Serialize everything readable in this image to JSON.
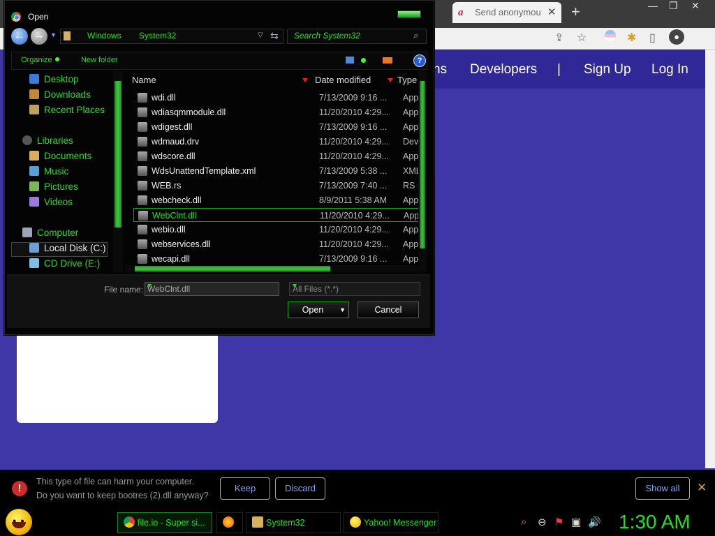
{
  "browser": {
    "tab_title": "Send anonymou",
    "tab_close": "✕",
    "new_tab": "+",
    "window_controls": {
      "minimize": "—",
      "restore": "❐",
      "close": "✕"
    },
    "toolbar_icons": [
      "share-icon",
      "star-icon",
      "profile-icon",
      "extensions-icon",
      "sidepanel-icon",
      "account-icon"
    ]
  },
  "site": {
    "nav_partial": "ns",
    "nav": [
      "Developers",
      "|",
      "Sign Up",
      "Log In"
    ]
  },
  "dialog": {
    "title": "Open",
    "address": [
      "Windows",
      "System32"
    ],
    "search_placeholder": "Search System32",
    "toolbar": {
      "organize": "Organize",
      "new_folder": "New folder",
      "help": "?"
    },
    "nav_pane": [
      {
        "label": "Desktop",
        "color": "#3a7bd5"
      },
      {
        "label": "Downloads",
        "color": "#c08a3a"
      },
      {
        "label": "Recent Places",
        "color": "#c0a060"
      },
      {
        "label": "Libraries",
        "color": "#555555"
      },
      {
        "label": "Documents",
        "color": "#d8b060"
      },
      {
        "label": "Music",
        "color": "#5aa0d8"
      },
      {
        "label": "Pictures",
        "color": "#7ab85a"
      },
      {
        "label": "Videos",
        "color": "#9a7ad8"
      },
      {
        "label": "Computer",
        "color": "#9aa6b8"
      },
      {
        "label": "Local Disk (C:)",
        "color": "#6ea0d8"
      },
      {
        "label": "CD Drive (E:)",
        "color": "#7ac0e8"
      }
    ],
    "columns": {
      "name": "Name",
      "date": "Date modified",
      "type": "Type"
    },
    "files": [
      {
        "name": "wdi.dll",
        "date": "7/13/2009 9:16 ...",
        "type": "Appli"
      },
      {
        "name": "wdiasqmmodule.dll",
        "date": "11/20/2010 4:29...",
        "type": "Appli"
      },
      {
        "name": "wdigest.dll",
        "date": "7/13/2009 9:16 ...",
        "type": "Appli"
      },
      {
        "name": "wdmaud.drv",
        "date": "11/20/2010 4:29...",
        "type": "Devic"
      },
      {
        "name": "wdscore.dll",
        "date": "11/20/2010 4:29...",
        "type": "Appli"
      },
      {
        "name": "WdsUnattendTemplate.xml",
        "date": "7/13/2009 5:38 ...",
        "type": "XML"
      },
      {
        "name": "WEB.rs",
        "date": "7/13/2009 7:40 ...",
        "type": "RS F"
      },
      {
        "name": "webcheck.dll",
        "date": "8/9/2011 5:38 AM",
        "type": "Appli"
      },
      {
        "name": "WebClnt.dll",
        "date": "11/20/2010 4:29...",
        "type": "Appli"
      },
      {
        "name": "webio.dll",
        "date": "11/20/2010 4:29...",
        "type": "Appli"
      },
      {
        "name": "webservices.dll",
        "date": "11/20/2010 4:29...",
        "type": "Appli"
      },
      {
        "name": "wecapi.dll",
        "date": "7/13/2009 9:16 ...",
        "type": "Appli"
      }
    ],
    "selected_file": "WebClnt.dll",
    "file_name_label": "File name:",
    "file_name_value": "WebClnt.dll",
    "file_type": "All Files (*.*)",
    "open_label": "Open",
    "cancel_label": "Cancel"
  },
  "download_bar": {
    "line1": "This type of file can harm your computer.",
    "line2": "Do you want to keep bootres (2).dll anyway?",
    "keep": "Keep",
    "discard": "Discard",
    "show_all": "Show all",
    "close": "✕"
  },
  "taskbar": {
    "items": [
      {
        "label": "file.io - Super si...",
        "icon_color": "#db4437"
      },
      {
        "label": "",
        "icon_color": "#ff7a00"
      },
      {
        "label": "System32",
        "icon_color": "#d8b060"
      },
      {
        "label": "Yahoo! Messenger",
        "icon_color": "#f0c020"
      }
    ],
    "clock": "1:30 AM"
  }
}
